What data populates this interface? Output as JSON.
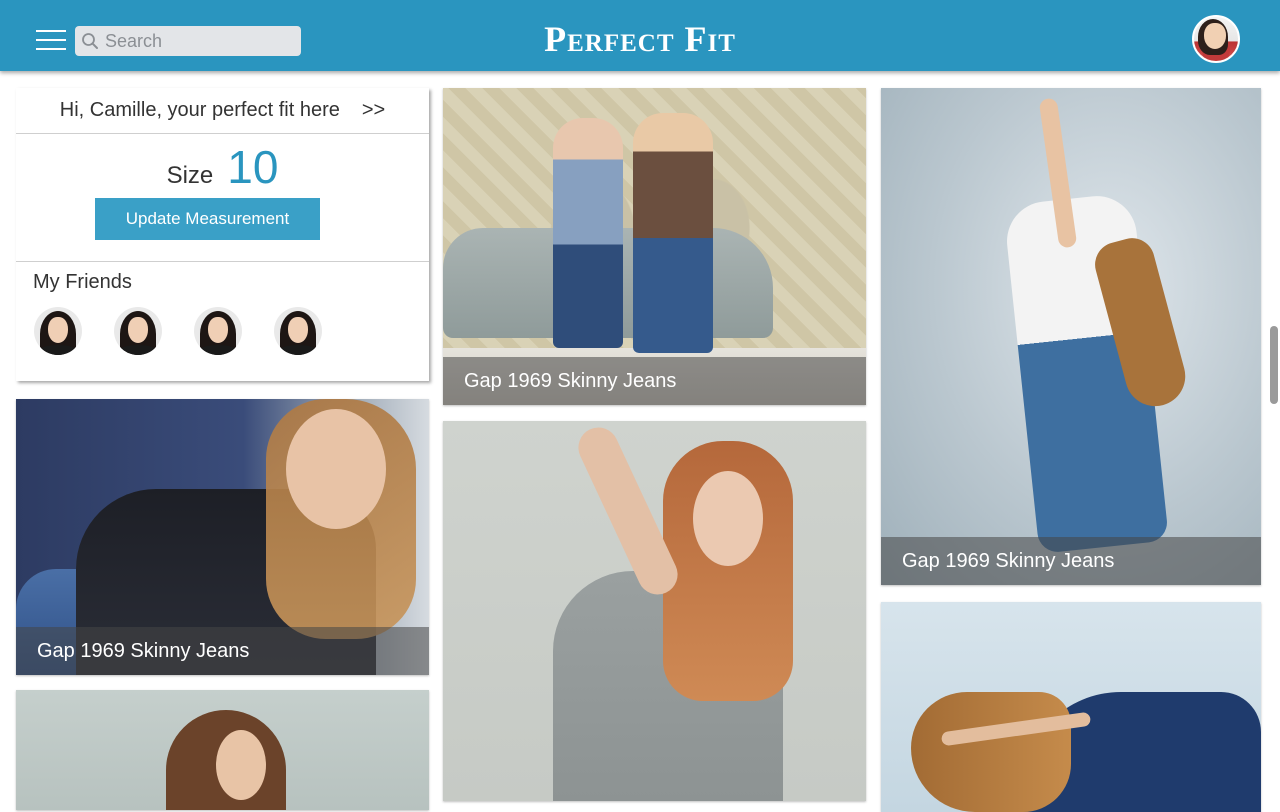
{
  "header": {
    "brand": "Perfect Fit",
    "menu_icon": "hamburger-menu-icon",
    "search_icon": "search-icon",
    "search_placeholder": "Search",
    "search_value": "",
    "accent_color": "#2a95bf"
  },
  "profile": {
    "greeting": "Hi, Camille, your perfect fit here",
    "greeting_arrow": ">>",
    "size_label": "Size",
    "size_value": "10",
    "update_button": "Update Measurement",
    "friends_title": "My Friends",
    "friends_count": 4
  },
  "products": [
    {
      "caption": "Gap 1969 Skinny Jeans"
    },
    {
      "caption": "Gap 1969 Skinny Jeans"
    },
    {
      "caption": "Gap 1969 Skinny Jeans"
    },
    {
      "caption": ""
    },
    {
      "caption": ""
    },
    {
      "caption": ""
    }
  ]
}
